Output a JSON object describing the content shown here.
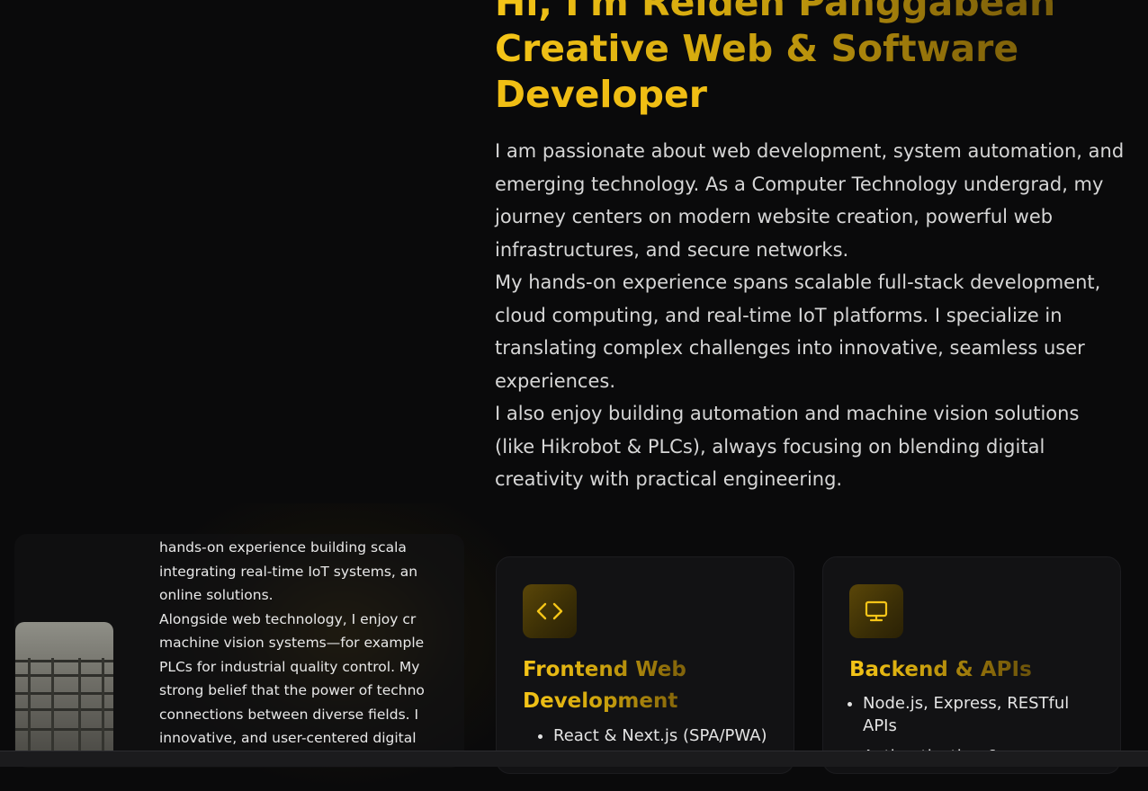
{
  "hero": {
    "title_line1": "Hi, I'm Reiden Panggabean",
    "title_line2": "Creative Web & Software",
    "title_line3": "Developer"
  },
  "bio": {
    "paragraphs": [
      "I am passionate about web development, system automation, and emerging technology. As a Computer Technology undergrad, my journey centers on modern website creation, powerful web infrastructures, and secure networks.",
      "My hands-on experience spans scalable full-stack development, cloud computing, and real-time IoT platforms. I specialize in translating complex challenges into innovative, seamless user experiences.",
      "I also enjoy building automation and machine vision solutions (like Hikrobot & PLCs), always focusing on blending digital creativity with practical engineering."
    ]
  },
  "about_card": {
    "lines": [
      "hands-on experience building scala",
      "integrating real-time IoT systems, an",
      "online solutions.",
      "Alongside web technology, I enjoy cr",
      "machine vision systems—for example",
      "PLCs for industrial quality control. My",
      "strong belief that the power of techno",
      "connections between diverse fields. I",
      "innovative, and user-centered digital"
    ]
  },
  "skills": [
    {
      "icon": "code-icon",
      "title": "Frontend Web Development",
      "items": [
        "React & Next.js (SPA/PWA)"
      ]
    },
    {
      "icon": "monitor-icon",
      "title": "Backend & APIs",
      "items": [
        "Node.js, Express, RESTful APIs",
        "Authentication & ..."
      ]
    }
  ],
  "colors": {
    "accent": "#f5c518",
    "background": "#0a0a0b"
  }
}
